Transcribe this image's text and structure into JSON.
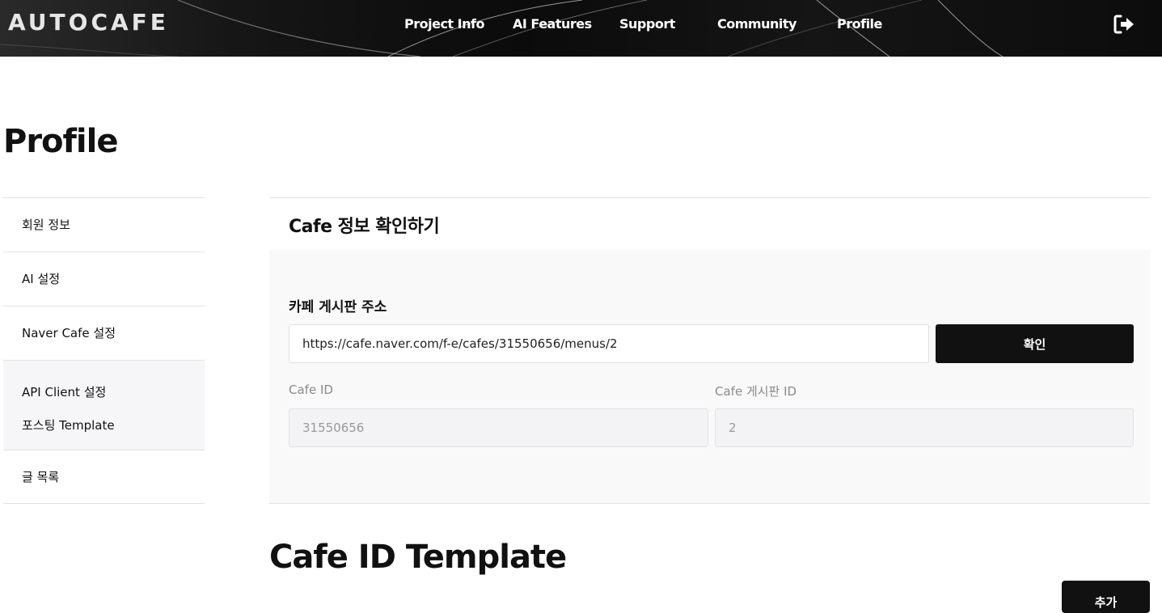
{
  "header": {
    "logo": "AUTOCAFE",
    "nav": [
      "Project Info",
      "AI Features",
      "Support",
      "Community",
      "Profile"
    ],
    "logout_icon": "logout-icon"
  },
  "page": {
    "title": "Profile"
  },
  "sidebar": {
    "items": [
      "회원 정보",
      "AI 설정",
      "Naver Cafe 설정"
    ],
    "group": [
      "API Client 설정",
      "포스팅 Template"
    ],
    "last_item": "글 목록"
  },
  "cafe_info": {
    "title": "Cafe 정보 확인하기",
    "url_label": "카페 게시판 주소",
    "url_value": "https://cafe.naver.com/f-e/cafes/31550656/menus/2",
    "confirm_label": "확인",
    "cafe_id_label": "Cafe ID",
    "cafe_id_value": "31550656",
    "board_id_label": "Cafe 게시판 ID",
    "board_id_value": "2"
  },
  "template_section": {
    "title": "Cafe ID Template",
    "add_label": "추가"
  },
  "colors": {
    "accent": "#111111",
    "panel": "#f9f9f9",
    "sidebar_active": "#f6f6f8"
  }
}
